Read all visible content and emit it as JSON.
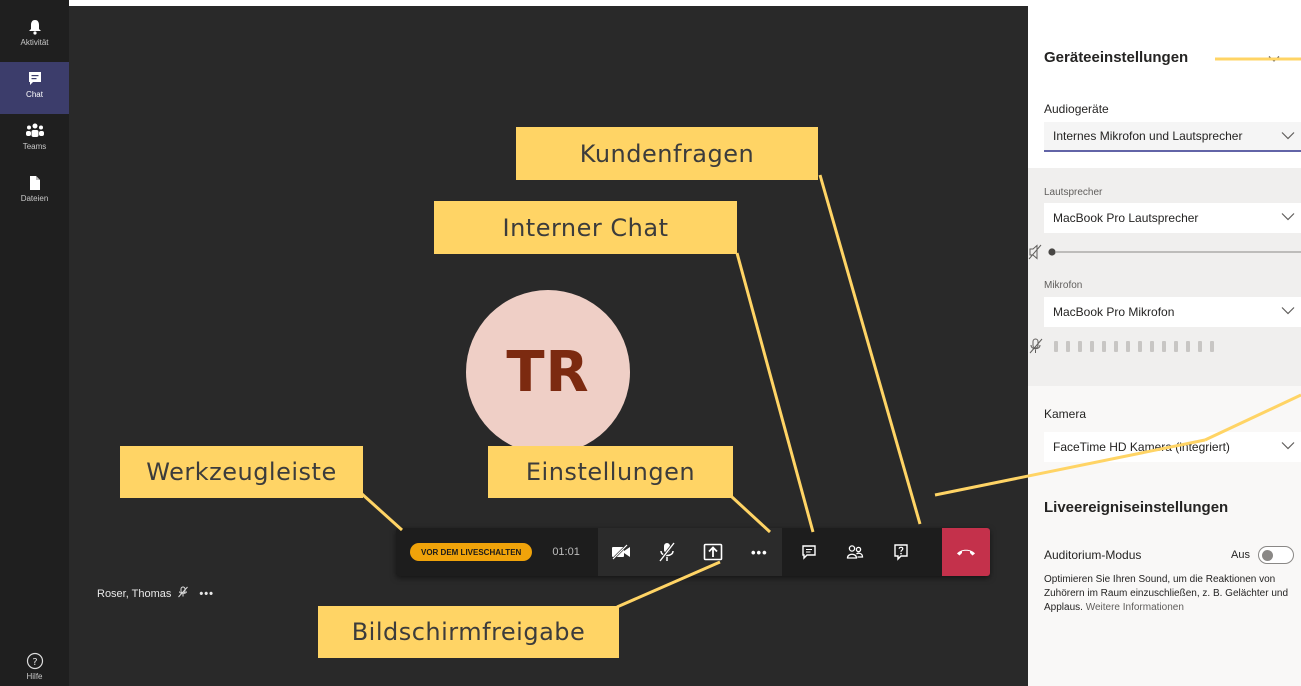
{
  "rail": {
    "items": [
      {
        "label": "Aktivität",
        "icon": "bell-icon"
      },
      {
        "label": "Chat",
        "icon": "chat-icon",
        "active": true
      },
      {
        "label": "Teams",
        "icon": "teams-icon"
      },
      {
        "label": "Dateien",
        "icon": "file-icon"
      }
    ],
    "help_label": "Hilfe"
  },
  "stage": {
    "avatar_initials": "TR",
    "presenter_name": "Roser, Thomas",
    "presenter_more": "•••"
  },
  "toolbar": {
    "status_pill": "VOR DEM LIVESCHALTEN",
    "timer": "01:01",
    "more": "•••"
  },
  "callouts": {
    "kundenfragen": "Kundenfragen",
    "interner_chat": "Interner Chat",
    "werkzeugleiste": "Werkzeugleiste",
    "einstellungen": "Einstellungen",
    "bildschirmfreigabe": "Bildschirmfreigabe"
  },
  "panel": {
    "title": "Geräteeinstellungen",
    "audio_label": "Audiogeräte",
    "audio_value": "Internes Mikrofon und Lautsprecher",
    "speaker_label": "Lautsprecher",
    "speaker_value": "MacBook Pro Lautsprecher",
    "mic_label": "Mikrofon",
    "mic_value": "MacBook Pro Mikrofon",
    "camera_label": "Kamera",
    "camera_value": "FaceTime HD Kamera (integriert)",
    "live_title": "Liveereigniseinstellungen",
    "auditorium_label": "Auditorium-Modus",
    "auditorium_state": "Aus",
    "description": "Optimieren Sie Ihren Sound, um die Reaktionen von Zuhörern im Raum einzuschließen, z. B. Gelächter und Applaus.",
    "more_info": "Weitere Informationen"
  },
  "colors": {
    "accent": "#6264a7",
    "callout": "#ffd465",
    "hangup": "#c4314b",
    "pill": "#f0a30a"
  }
}
